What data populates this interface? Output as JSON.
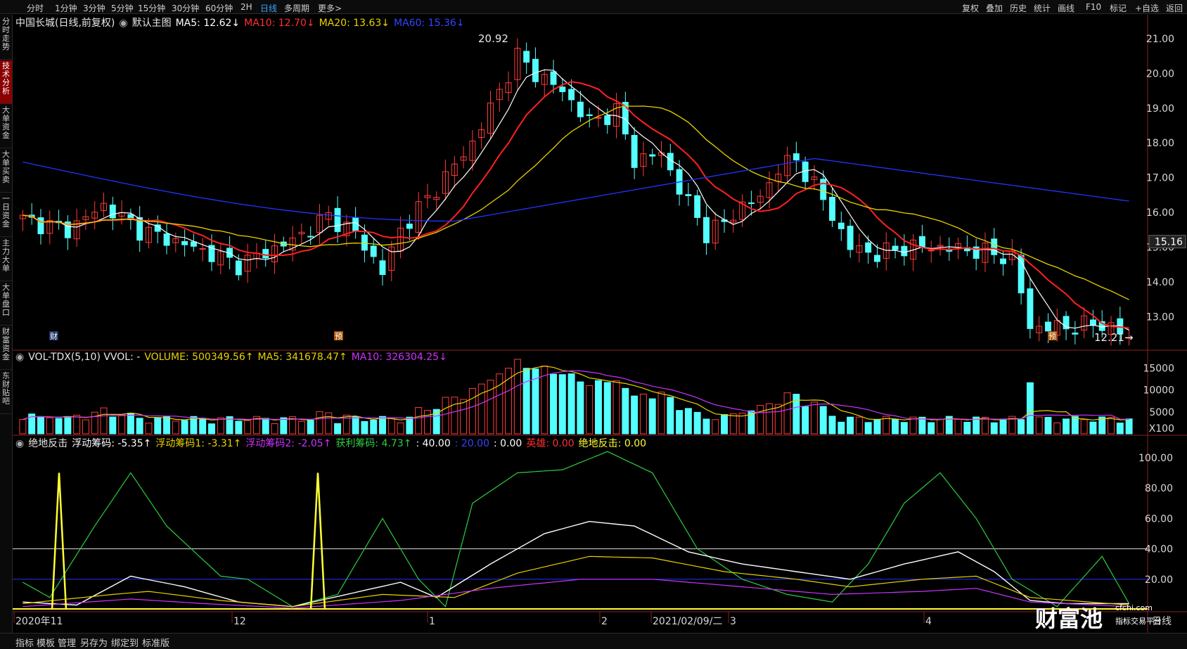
{
  "topbar": {
    "periods": [
      "分时",
      "1分钟",
      "3分钟",
      "5分钟",
      "15分钟",
      "30分钟",
      "60分钟",
      "2H",
      "日线",
      "多周期",
      "更多>"
    ],
    "active_period": "日线",
    "right_tools": [
      "复权",
      "叠加",
      "历史",
      "统计",
      "画线",
      "F10",
      "标记",
      "+自选",
      "返回"
    ]
  },
  "sidebar": {
    "items": [
      "分时走势",
      "技术分析",
      "大单资金",
      "大单买卖",
      "一日资金",
      "主力大单",
      "大单盘口",
      "财富资金",
      "东财贴吧"
    ],
    "active_index": 1
  },
  "main_chart": {
    "stock": "中国长城(日线,前复权)",
    "template": "默认主图",
    "ma5": "MA5: 12.62↓",
    "ma10": "MA10: 12.70↓",
    "ma20": "MA20: 13.63↓",
    "ma60": "MA60: 15.36↓",
    "high_label": "20.92",
    "low_label": "12.21",
    "current_price": "15.16",
    "y_ticks": [
      "21.00",
      "20.00",
      "19.00",
      "18.00",
      "17.00",
      "16.00",
      "15.00",
      "14.00",
      "13.00"
    ],
    "markers": [
      "财",
      "预",
      "预"
    ]
  },
  "vol_chart": {
    "title": "VOL-TDX(5,10) VVOL: -",
    "volume": "VOLUME: 500349.56↑",
    "ma5": "MA5: 341678.47↑",
    "ma10": "MA10: 326304.25↓",
    "y_ticks": [
      "15000",
      "10000",
      "5000",
      "X100"
    ]
  },
  "ind_chart": {
    "name": "绝地反击",
    "f1": "浮动筹码: -5.35↑",
    "f2": "浮动筹码1: -3.31↑",
    "f3": "浮动筹码2: -2.05↑",
    "f4": "获利筹码: 4.73↑",
    "f5": ": 40.00",
    "f6": ": 20.00",
    "f7": ": 0.00",
    "f8": "英雄: 0.00",
    "f9": "绝地反击: 0.00",
    "y_ticks": [
      "100.00",
      "80.00",
      "60.00",
      "40.00",
      "20.00"
    ]
  },
  "x_axis": {
    "labels": [
      "2020年11",
      "12",
      "1",
      "2",
      "2021/02/09/二",
      "3",
      "4"
    ],
    "period": "日线"
  },
  "bottombar": {
    "items": [
      "指标",
      "模板",
      "管理",
      "另存为",
      "绑定到",
      "标准版"
    ]
  },
  "watermark": {
    "brand": "财富池",
    "url": "cfchi.com",
    "slogan": "指标交易平台"
  },
  "colors": {
    "up": "#ff3b3b",
    "down": "#54ffff",
    "ma5": "#ffffff",
    "ma10": "#ff2020",
    "ma20": "#e8d200",
    "ma60": "#2233ff",
    "vol_ma5": "#e8d200",
    "vol_ma10": "#cc33ff",
    "line_green": "#2ecc40",
    "line_yellow": "#ffff33"
  }
}
